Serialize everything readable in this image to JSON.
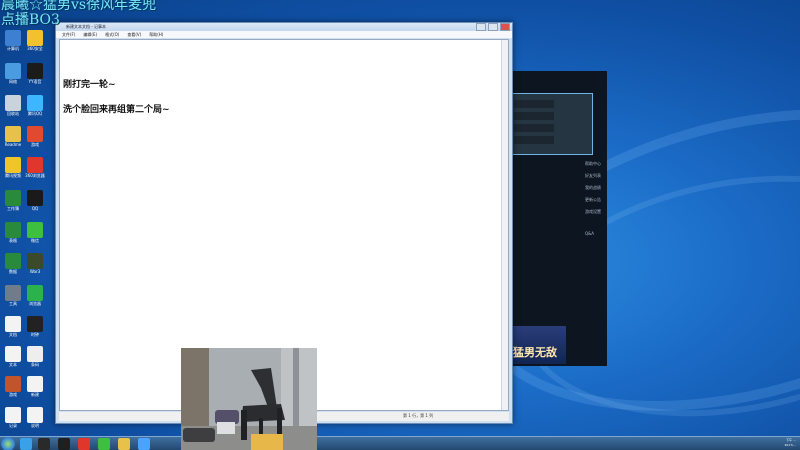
{
  "stream_overlay": {
    "title": "晨曦☆猛男vs徐风年麦兜",
    "subtitle": "点播BO3"
  },
  "desktop_icons": [
    {
      "icon": "computer-icon",
      "label": "计算机",
      "color": "#3d7fd0"
    },
    {
      "icon": "app-icon",
      "label": "360安全",
      "color": "#f2c22e"
    },
    {
      "icon": "network-icon",
      "label": "网络",
      "color": "#4a9be0"
    },
    {
      "icon": "app-icon",
      "label": "YY语音",
      "color": "#1b1b1b"
    },
    {
      "icon": "recycle-bin-icon",
      "label": "回收站",
      "color": "#c9d3dc"
    },
    {
      "icon": "app-icon",
      "label": "腾讯QQ",
      "color": "#3cb6ff"
    },
    {
      "icon": "folder-icon",
      "label": "Readme",
      "color": "#e8c14a"
    },
    {
      "icon": "app-icon",
      "label": "游戏",
      "color": "#e04a2e"
    },
    {
      "icon": "app-icon",
      "label": "腾讯视频",
      "color": "#f0c52a"
    },
    {
      "icon": "app-icon",
      "label": "360浏览器",
      "color": "#e0362b"
    },
    {
      "icon": "excel-icon",
      "label": "工作簿",
      "color": "#2a8a3c"
    },
    {
      "icon": "qq-icon",
      "label": "QQ",
      "color": "#1a1a1a"
    },
    {
      "icon": "excel-icon",
      "label": "表格",
      "color": "#2a8a3c"
    },
    {
      "icon": "wechat-icon",
      "label": "微信",
      "color": "#3fbf3f"
    },
    {
      "icon": "excel-icon",
      "label": "数据",
      "color": "#2a8a3c"
    },
    {
      "icon": "app-icon",
      "label": "War3",
      "color": "#3b4a2a"
    },
    {
      "icon": "app-icon",
      "label": "工具",
      "color": "#6f7d8a"
    },
    {
      "icon": "app-icon",
      "label": "浏览器",
      "color": "#2bb24c"
    },
    {
      "icon": "document-icon",
      "label": "文档",
      "color": "#f3f3f3"
    },
    {
      "icon": "clock-icon",
      "label": "时钟",
      "color": "#222222"
    },
    {
      "icon": "document-icon",
      "label": "文本",
      "color": "#f3f3f3"
    },
    {
      "icon": "barcode-icon",
      "label": "条码",
      "color": "#eeeeee"
    },
    {
      "icon": "app-icon",
      "label": "游戏",
      "color": "#c0542a"
    },
    {
      "icon": "document-icon",
      "label": "新建",
      "color": "#f3f3f3"
    },
    {
      "icon": "document-icon",
      "label": "记录",
      "color": "#f3f3f3"
    },
    {
      "icon": "document-icon",
      "label": "说明",
      "color": "#f3f3f3"
    }
  ],
  "notepad": {
    "title": "新建文本文档 - 记事本",
    "menus": [
      "文件(F)",
      "编辑(E)",
      "格式(O)",
      "查看(V)",
      "帮助(H)"
    ],
    "lines": [
      "刚打完一轮~",
      "洗个脸回来再组第二个局~"
    ],
    "status_position": "第 1 行，第 1 列"
  },
  "dark_app": {
    "banner_text": "猛男无敌",
    "side_items": [
      "帮助中心",
      "好友列表",
      "我的战绩",
      "更新公告",
      "游戏设置",
      "Q&A"
    ]
  },
  "taskbar": {
    "items": [
      {
        "icon": "ie-icon",
        "color": "#3aa0e8"
      },
      {
        "icon": "app-icon",
        "color": "#2a2a2a"
      },
      {
        "icon": "app-icon",
        "color": "#1f1f1f"
      },
      {
        "icon": "app-icon",
        "color": "#e0362b"
      },
      {
        "icon": "app-icon",
        "color": "#3fbf3f"
      },
      {
        "icon": "folder-icon",
        "color": "#e8c14a"
      },
      {
        "icon": "app-icon",
        "color": "#4aa3ff"
      }
    ],
    "clock_time": "下午 ...",
    "clock_date": "2017/..."
  }
}
